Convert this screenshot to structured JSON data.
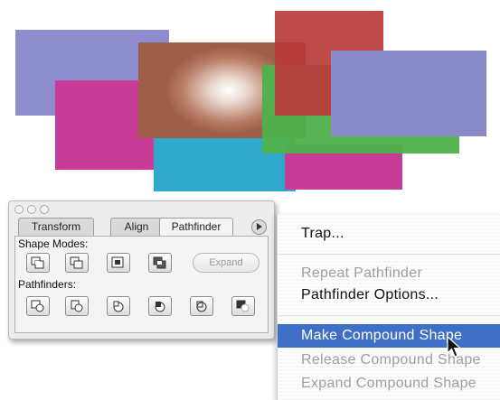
{
  "canvas": {
    "shapes": [
      {
        "name": "lavender-rect",
        "color": "#8d8ccc"
      },
      {
        "name": "magenta-rect",
        "color": "#c63c96"
      },
      {
        "name": "cyan-rect",
        "color": "#2fa8cc"
      },
      {
        "name": "green-rect",
        "color": "#4fb04c"
      },
      {
        "name": "red-rect",
        "color": "#b83b3b"
      },
      {
        "name": "gradient-rect",
        "color": "#a86d57"
      },
      {
        "name": "violet-rect",
        "color": "#8a8ac8"
      }
    ]
  },
  "panel": {
    "window_buttons": [
      "close-button",
      "minimize-button",
      "zoom-button"
    ],
    "tabs": [
      {
        "label": "Transform",
        "active": false
      },
      {
        "label": "Align",
        "active": false
      },
      {
        "label": "Pathfinder",
        "active": true
      }
    ],
    "shape_modes_label": "Shape Modes:",
    "shape_mode_tools": [
      "add-to-shape-area-icon",
      "subtract-from-shape-area-icon",
      "intersect-shape-areas-icon",
      "exclude-overlapping-shape-areas-icon"
    ],
    "expand_label": "Expand",
    "pathfinders_label": "Pathfinders:",
    "pathfinder_tools": [
      "divide-icon",
      "trim-icon",
      "merge-icon",
      "crop-icon",
      "outline-icon",
      "minus-back-icon"
    ]
  },
  "menu": {
    "items": [
      {
        "label": "Trap...",
        "state": "enabled"
      },
      {
        "label": "Repeat Pathfinder",
        "state": "disabled"
      },
      {
        "label": "Pathfinder Options...",
        "state": "enabled"
      },
      {
        "label": "Make Compound Shape",
        "state": "highlighted"
      },
      {
        "label": "Release Compound Shape",
        "state": "disabled"
      },
      {
        "label": "Expand Compound Shape",
        "state": "disabled"
      }
    ],
    "highlight_color": "#3f6fc6"
  }
}
